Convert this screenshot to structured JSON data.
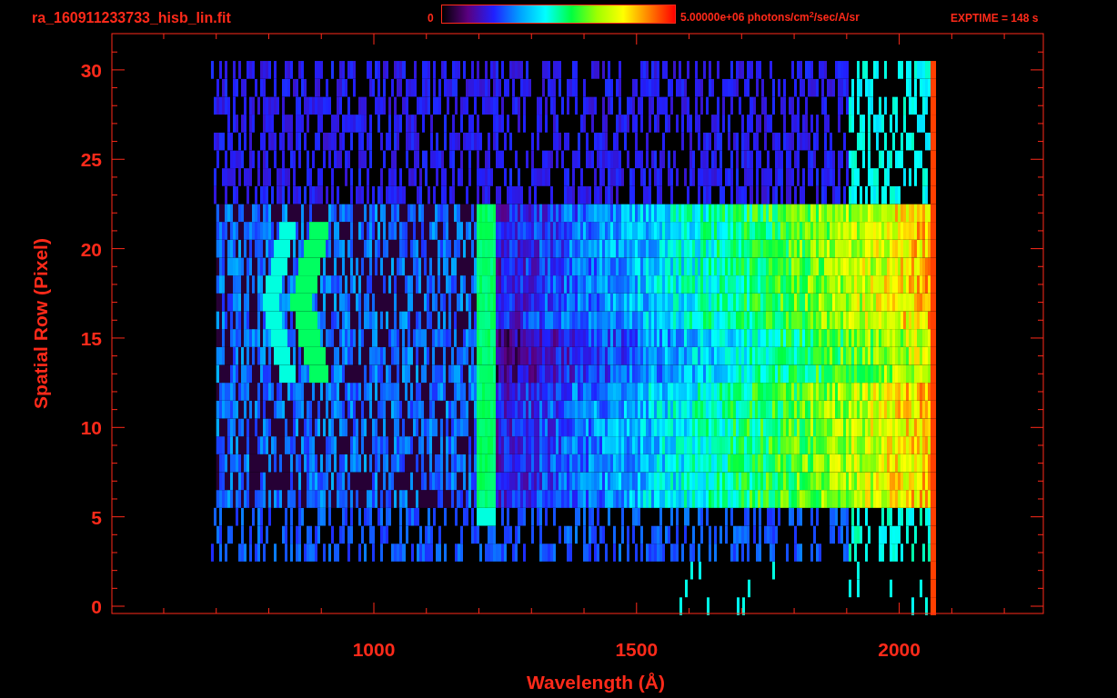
{
  "title": "ra_160911233733_hisb_lin.fit",
  "colorbar": {
    "min_label": "0",
    "max_label": "5.00000e+06 photons/cm$^{2}$/sec/A/sr"
  },
  "exposure": "EXPTIME = 148 s",
  "plot": {
    "xlabel": "Wavelength (Å)",
    "ylabel": "Spatial Row (Pixel)",
    "xticks": [
      "1000",
      "1500",
      "2000"
    ],
    "yticks": [
      "30",
      "25",
      "20",
      "15",
      "10",
      "5",
      "0"
    ]
  }
}
